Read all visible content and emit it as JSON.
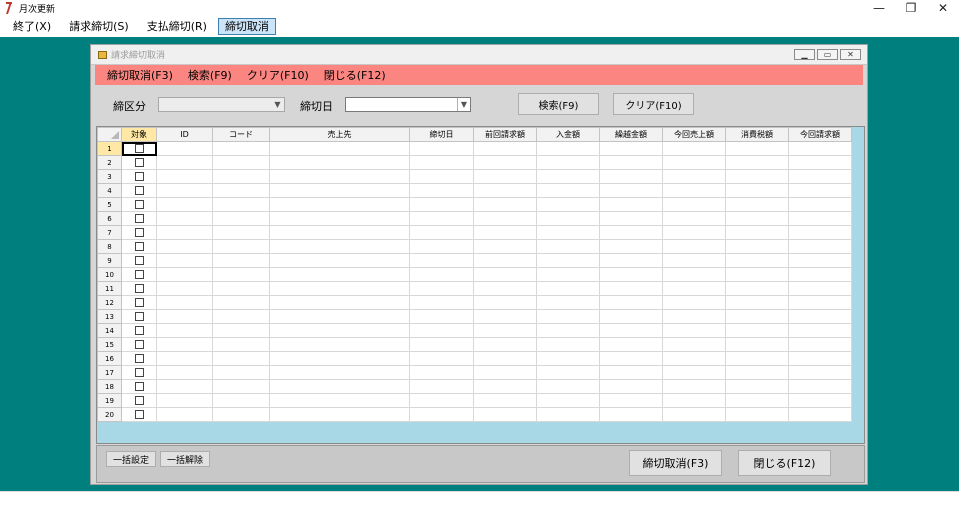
{
  "window": {
    "title": "月次更新",
    "controls": {
      "minimize": "—",
      "restore": "❐",
      "close": "✕"
    }
  },
  "menu": [
    {
      "label": "終了(X)"
    },
    {
      "label": "請求締切(S)"
    },
    {
      "label": "支払締切(R)"
    },
    {
      "label": "締切取消"
    }
  ],
  "child": {
    "title": "請求締切取消",
    "menu": [
      {
        "label": "締切取消(F3)"
      },
      {
        "label": "検索(F9)"
      },
      {
        "label": "クリア(F10)"
      },
      {
        "label": "閉じる(F12)"
      }
    ],
    "filters": {
      "category_label": "締区分",
      "category_value": "",
      "date_label": "締切日",
      "date_value": ""
    },
    "buttons": {
      "search": "検索(F9)",
      "clear": "クリア(F10)"
    },
    "grid": {
      "columns": [
        "対象",
        "ID",
        "コード",
        "売上先",
        "締切日",
        "前回請求額",
        "入金額",
        "繰越金額",
        "今回売上額",
        "消費税額",
        "今回請求額"
      ],
      "row_numbers": [
        "1",
        "2",
        "3",
        "4",
        "5",
        "6",
        "7",
        "8",
        "9",
        "10",
        "11",
        "12",
        "13",
        "14",
        "15",
        "16",
        "17",
        "18",
        "19",
        "20"
      ]
    },
    "bottom": {
      "select_all": "一括設定",
      "deselect_all": "一括解除",
      "cancel_close": "締切取消(F3)",
      "close": "閉じる(F12)"
    }
  },
  "colors": {
    "desktop": "#007f7f",
    "red_menu": "#fb8581",
    "grid_empty": "#a8d8e6",
    "selected_header": "#ffe8a6"
  }
}
